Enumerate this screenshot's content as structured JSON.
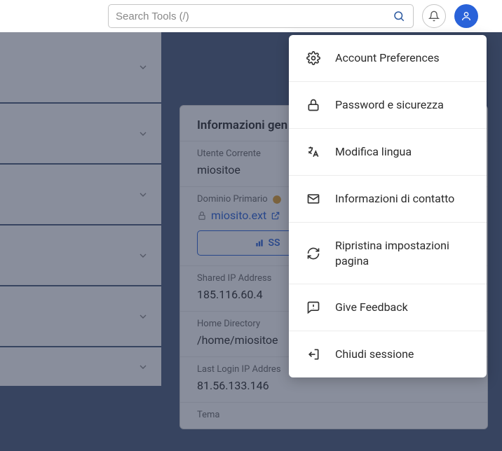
{
  "search": {
    "placeholder": "Search Tools (/)"
  },
  "card": {
    "title": "Informazioni gen",
    "user_label": "Utente Corrente",
    "user_value": "miositoe",
    "domain_label": "Dominio Primario",
    "domain_value": "miosito.ext",
    "ssl_label": "SS",
    "ip_label": "Shared IP Address",
    "ip_value": "185.116.60.4",
    "home_label": "Home Directory",
    "home_value": "/home/miositoe",
    "last_label": "Last Login IP Addres",
    "last_value": "81.56.133.146",
    "theme_label": "Tema"
  },
  "menu": {
    "items": [
      "Account Preferences",
      "Password e sicurezza",
      "Modifica lingua",
      "Informazioni di contatto",
      "Ripristina impostazioni pagina",
      "Give Feedback",
      "Chiudi sessione"
    ]
  }
}
